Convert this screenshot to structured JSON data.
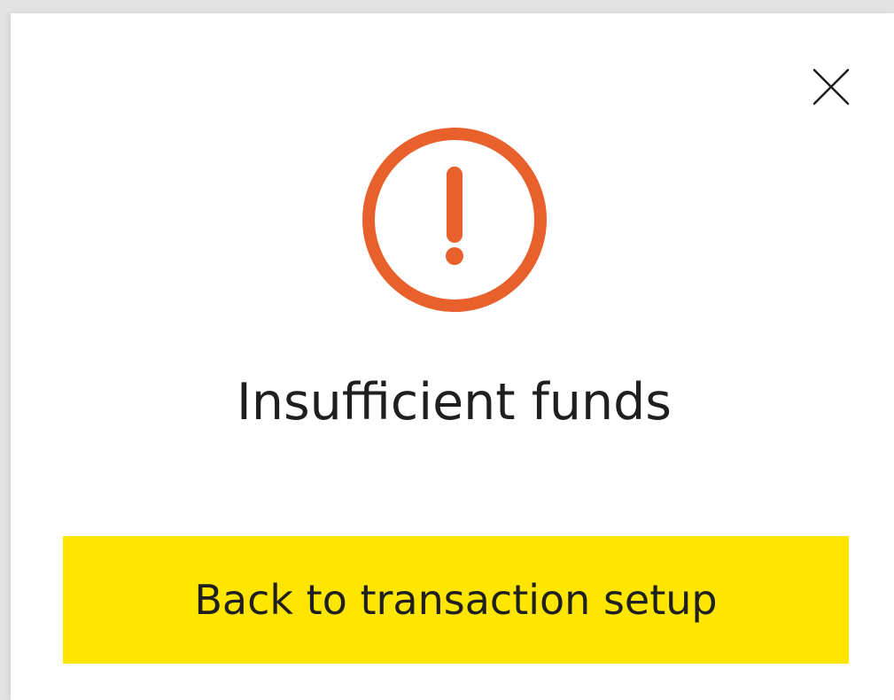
{
  "dialog": {
    "title": "Insufficient funds",
    "primary_button_label": "Back to transaction setup",
    "icon": "alert-circle-icon",
    "close_icon": "close-icon"
  },
  "colors": {
    "backdrop": "#e3e3e3",
    "surface": "#ffffff",
    "alert": "#e8602c",
    "primary_button": "#ffe600",
    "text": "#1f1f1f"
  }
}
